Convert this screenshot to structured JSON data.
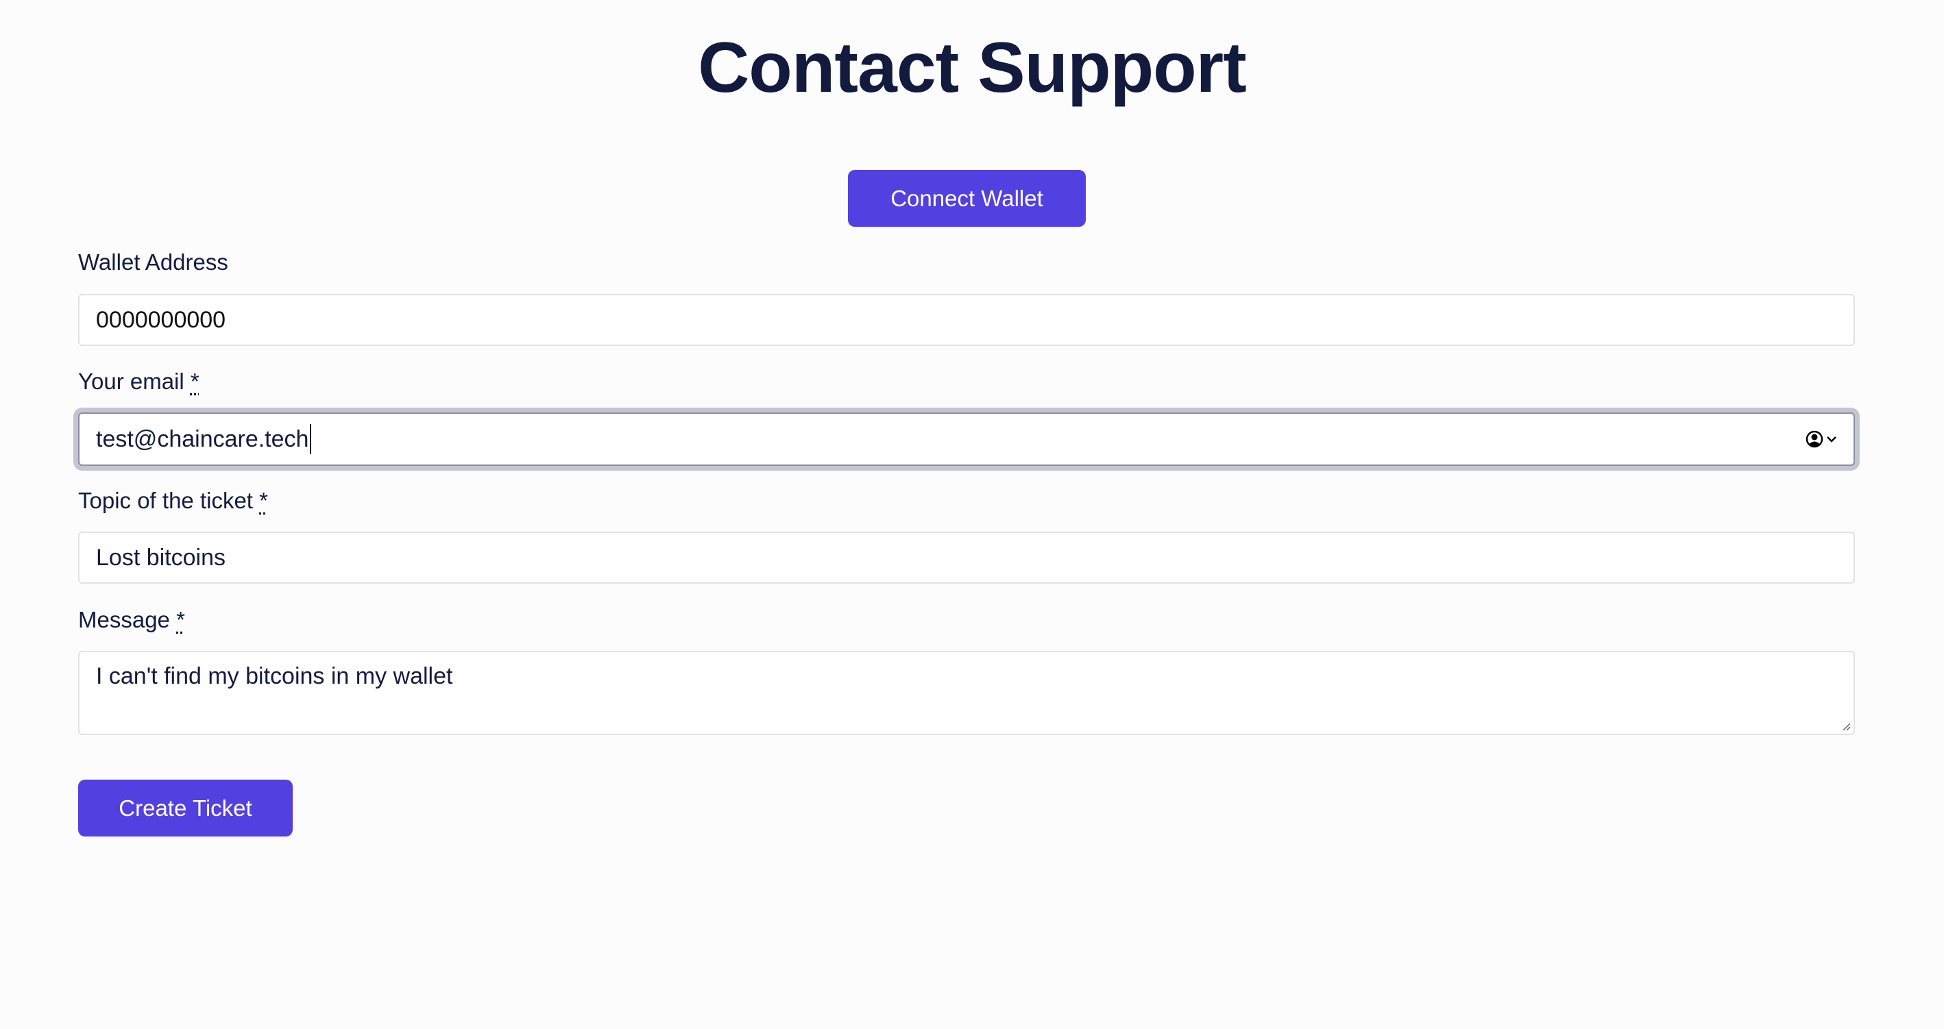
{
  "page": {
    "title": "Contact Support"
  },
  "connect_button": {
    "label": "Connect Wallet"
  },
  "form": {
    "wallet": {
      "label": "Wallet Address",
      "value": "0000000000"
    },
    "email": {
      "label": "Your email",
      "required_mark": "*",
      "value": "test@chaincare.tech",
      "autofill_icon": "contact-autofill-icon"
    },
    "topic": {
      "label": "Topic of the ticket",
      "required_mark": "*",
      "value": "Lost bitcoins"
    },
    "message": {
      "label": "Message",
      "required_mark": "*",
      "value": "I can't find my bitcoins in my wallet"
    }
  },
  "create_button": {
    "label": "Create Ticket"
  },
  "colors": {
    "accent": "#5340e0",
    "text": "#141b3f",
    "background": "#fcfcfc"
  }
}
